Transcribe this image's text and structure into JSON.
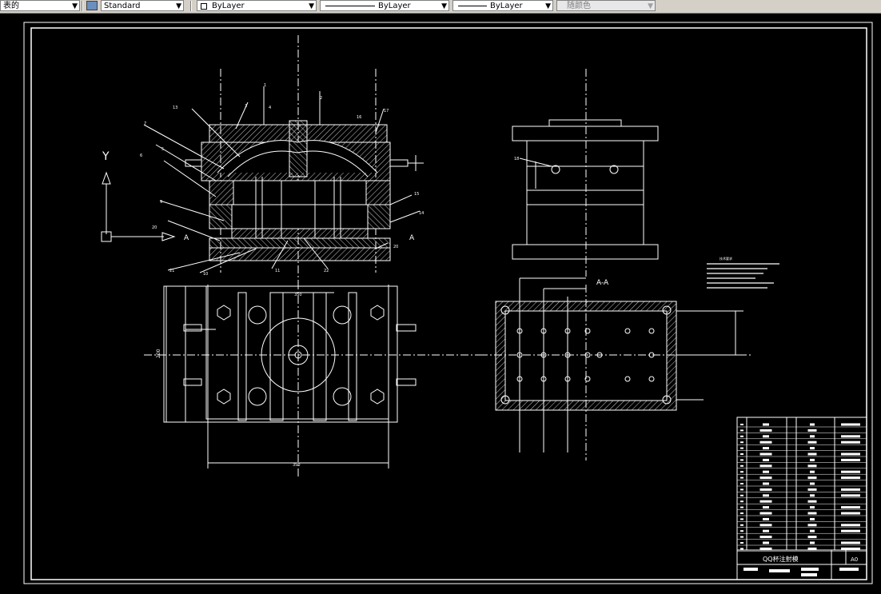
{
  "toolbar": {
    "layer_value": "表的",
    "textstyle_value": "Standard",
    "layer_combo_value": "ByLayer",
    "linetype_value": "ByLayer",
    "lineweight_value": "ByLayer",
    "color_value": "随颜色"
  },
  "drawing": {
    "ucs_y_label": "Y",
    "section_marker": "A",
    "section_marker_left": "A",
    "section_title": "A-A",
    "dim_vertical_bottom_left": "200",
    "dim_top_plan": "350",
    "dim_bottom_plan": "350",
    "balloons": [
      "1",
      "2",
      "3",
      "4",
      "5",
      "6",
      "7",
      "8",
      "9",
      "10",
      "11",
      "12",
      "13",
      "14",
      "15",
      "16",
      "17",
      "18",
      "19",
      "20",
      "21",
      "22"
    ],
    "balloon_18_side": "18",
    "title_block_name": "QQ杯注射模",
    "title_block_size": "A0",
    "tech_req_heading": "技术要求"
  },
  "colors": {
    "background": "#000000",
    "lines": "#ffffff",
    "toolbar": "#d4d0c8"
  }
}
